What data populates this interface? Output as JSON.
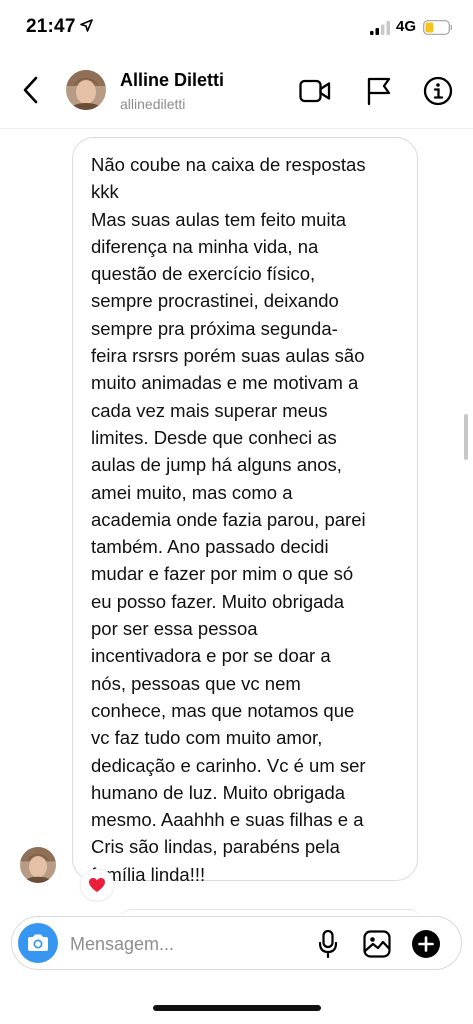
{
  "status_bar": {
    "time": "21:47",
    "network": "4G",
    "location_icon": "location-arrow-icon",
    "signal_icon": "signal-bars-icon",
    "battery_icon": "battery-icon",
    "battery_color": "#f5c518"
  },
  "header": {
    "back_icon": "chevron-left-icon",
    "name": "Alline Diletti",
    "username": "allinediletti",
    "actions": [
      "video-call-icon",
      "flag-icon",
      "info-icon"
    ]
  },
  "message": {
    "lines": [
      "Não coube na caixa de respostas",
      "kkk",
      "Mas suas aulas tem feito muita",
      "diferença na minha vida, na",
      "questão de exercício físico,",
      "sempre procrastinei, deixando",
      "sempre pra próxima segunda-",
      "feira rsrsrs porém suas aulas são",
      "muito animadas e me motivam a",
      "cada vez mais superar meus",
      "limites. Desde que conheci as",
      "aulas de jump há alguns anos,",
      "amei muito, mas como a",
      "academia onde fazia parou, parei",
      "também. Ano passado decidi",
      "mudar e fazer por mim o que só",
      "eu posso fazer. Muito obrigada",
      "por ser essa pessoa",
      "incentivadora e por se doar a",
      "nós, pessoas que vc nem",
      "conhece, mas que notamos que",
      "vc faz tudo com muito amor,",
      "dedicação e carinho. Vc é um ser",
      "humano de luz. Muito obrigada",
      "mesmo. Aaahhh e suas filhas e a",
      "Cris são lindas, parabéns pela",
      "família linda!!!"
    ],
    "reaction": "❤️"
  },
  "composer": {
    "placeholder": "Mensagem...",
    "value": "",
    "camera_icon": "camera-icon",
    "icons": [
      "microphone-icon",
      "gallery-icon",
      "plus-icon"
    ],
    "accent_color": "#3797f0"
  }
}
